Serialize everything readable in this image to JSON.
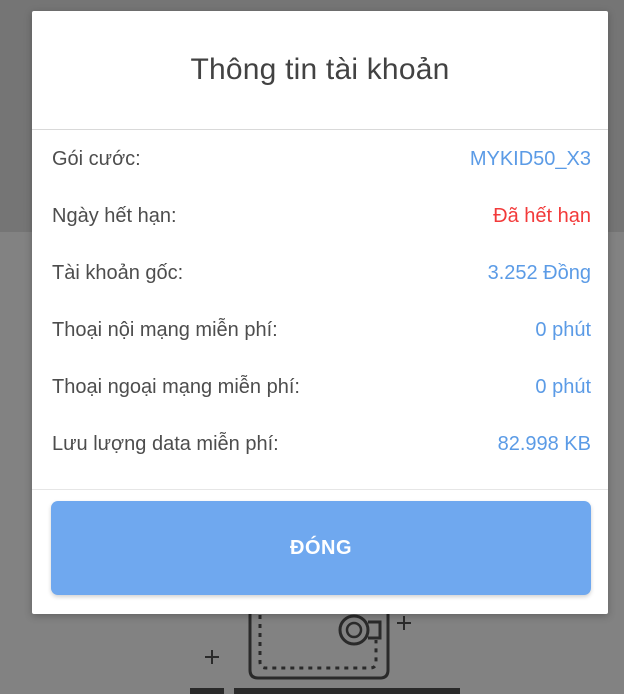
{
  "dialog": {
    "title": "Thông tin tài khoản",
    "rows": [
      {
        "label": "Gói cước:",
        "value": "MYKID50_X3"
      },
      {
        "label": "Ngày hết hạn:",
        "value": "Đã hết hạn"
      },
      {
        "label": "Tài khoản gốc:",
        "value": "3.252 Đồng"
      },
      {
        "label": "Thoại nội mạng miễn phí:",
        "value": "0 phút"
      },
      {
        "label": "Thoại ngoại mạng miễn phí:",
        "value": "0 phút"
      },
      {
        "label": "Lưu lượng data miễn phí:",
        "value": "82.998 KB"
      }
    ],
    "close_label": "ĐÓNG"
  },
  "colors": {
    "value_blue": "#5b9be6",
    "expired_red": "#f23a3a",
    "button_blue": "#6fa8ef",
    "overlay": "#7d7d7d"
  }
}
